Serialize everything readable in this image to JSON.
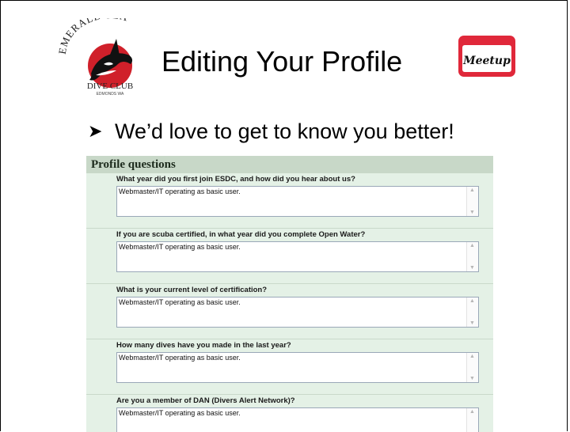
{
  "slide": {
    "title": "Editing Your Profile",
    "bullet": "We’d love to get to know you better!",
    "bullet_icon": "arrow-right-icon"
  },
  "logo": {
    "arc_text": "EMERALD SEA",
    "name_text": "DIVE CLUB",
    "location_text": "EDMONDS WA",
    "accent_color": "#d0202a"
  },
  "meetup_badge": {
    "text": "Meetup",
    "accent_color": "#e0283a"
  },
  "profile": {
    "heading": "Profile questions",
    "questions": [
      {
        "label": "What year did you first join ESDC, and how did you hear about us?",
        "value": "Webmaster/IT operating as basic user."
      },
      {
        "label": "If you are scuba certified, in what year did you complete Open Water?",
        "value": "Webmaster/IT operating as basic user."
      },
      {
        "label": "What is your current level of certification?",
        "value": "Webmaster/IT operating as basic user."
      },
      {
        "label": "How many dives have you made in the last year?",
        "value": "Webmaster/IT operating as basic user."
      },
      {
        "label": "Are you a member of DAN (Divers Alert Network)?",
        "value": "Webmaster/IT operating as basic user."
      }
    ]
  }
}
